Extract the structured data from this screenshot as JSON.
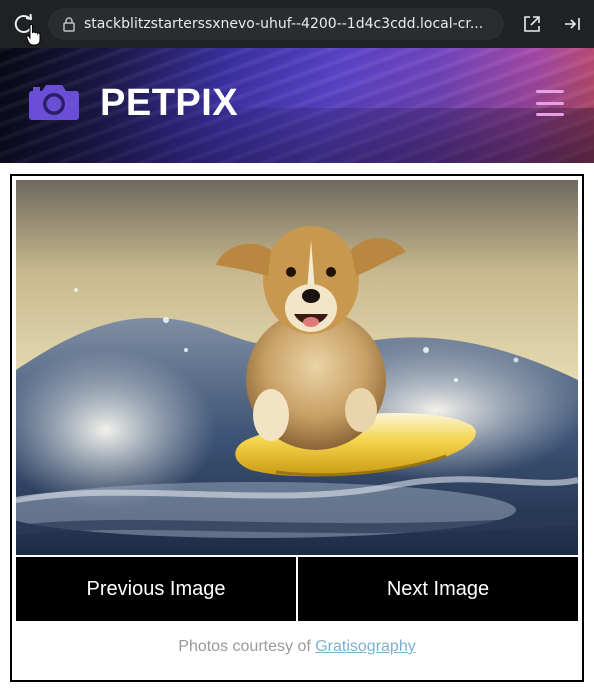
{
  "browser": {
    "url": "stackblitzstarterssxnevo-uhuf--4200--1d4c3cdd.local-cr..."
  },
  "header": {
    "brand": "PETPIX",
    "logo_icon": "camera-icon",
    "menu_icon": "hamburger-menu-icon"
  },
  "gallery": {
    "image_subject": "dog surfing on a yellow surfboard in a wave",
    "prev_label": "Previous Image",
    "next_label": "Next Image"
  },
  "credit": {
    "prefix": "Photos courtesy of",
    "link_label": "Gratisography"
  },
  "colors": {
    "browser_bar": "#202124",
    "header_gradient_start": "#080814",
    "header_gradient_mid": "#5944c8",
    "header_gradient_end": "#d8566d",
    "menu_icon": "#e6a0e6",
    "button_bg": "#000000",
    "credit_text": "#999999",
    "link": "#7fb0cf"
  }
}
